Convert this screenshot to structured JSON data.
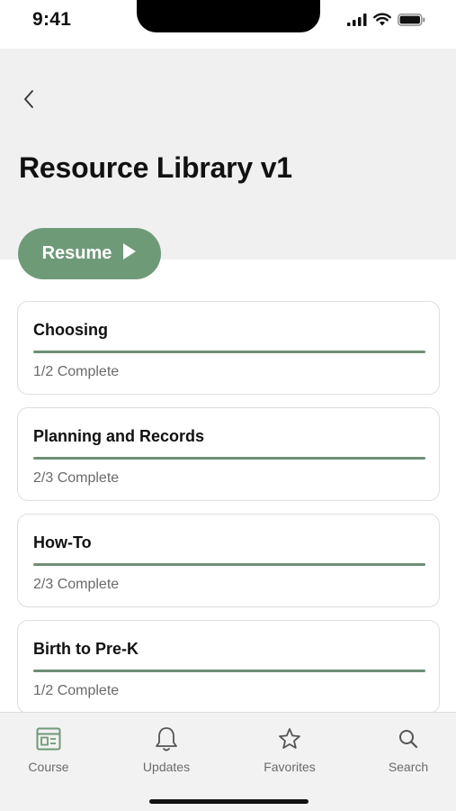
{
  "status_bar": {
    "time": "9:41"
  },
  "header": {
    "title": "Resource Library v1"
  },
  "resume": {
    "label": "Resume"
  },
  "cards": [
    {
      "title": "Choosing",
      "status": "1/2 Complete",
      "progress": 1.0
    },
    {
      "title": "Planning and Records",
      "status": "2/3 Complete",
      "progress": 1.0
    },
    {
      "title": "How-To",
      "status": "2/3 Complete",
      "progress": 1.0
    },
    {
      "title": "Birth to Pre-K",
      "status": "1/2 Complete",
      "progress": 1.0
    }
  ],
  "tab_bar": {
    "items": [
      {
        "label": "Course",
        "icon": "course-icon",
        "active": true
      },
      {
        "label": "Updates",
        "icon": "bell-icon",
        "active": false
      },
      {
        "label": "Favorites",
        "icon": "star-icon",
        "active": false
      },
      {
        "label": "Search",
        "icon": "search-icon",
        "active": false
      }
    ]
  },
  "colors": {
    "accent": "#6e9a78",
    "progress": "#6e8f76",
    "header_bg": "#f0f0f0",
    "tab_bar_bg": "#f2f2f2"
  }
}
